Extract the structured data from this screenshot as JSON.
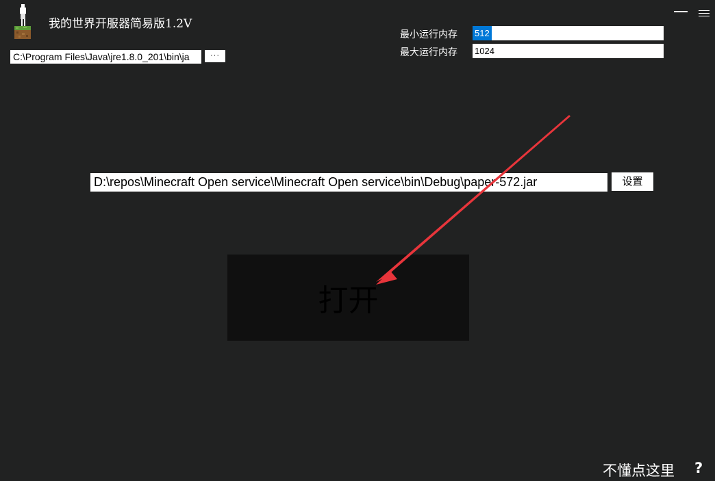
{
  "app": {
    "title": "我的世界开服器简易版1.2V",
    "logo_icon": "minecraft-grass-block-icon"
  },
  "window_controls": {
    "minimize_icon": "minimize-icon",
    "menu_icon": "hamburger-menu-icon"
  },
  "java": {
    "path_value": "C:\\Program Files\\Java\\jre1.8.0_201\\bin\\ja",
    "browse_label": "···"
  },
  "memory": {
    "min_label": "最小运行内存",
    "min_value": "512",
    "max_label": "最大运行内存",
    "max_value": "1024"
  },
  "server": {
    "jar_path": "D:\\repos\\Minecraft Open service\\Minecraft Open service\\bin\\Debug\\paper-572.jar",
    "settings_label": "设置"
  },
  "actions": {
    "open_label": "打开"
  },
  "help": {
    "link_label": "不懂点这里",
    "question_label": "?"
  },
  "colors": {
    "background": "#212222",
    "open_button_bg": "#101010",
    "selection": "#0078d7",
    "annotation_arrow": "#e8353b"
  }
}
